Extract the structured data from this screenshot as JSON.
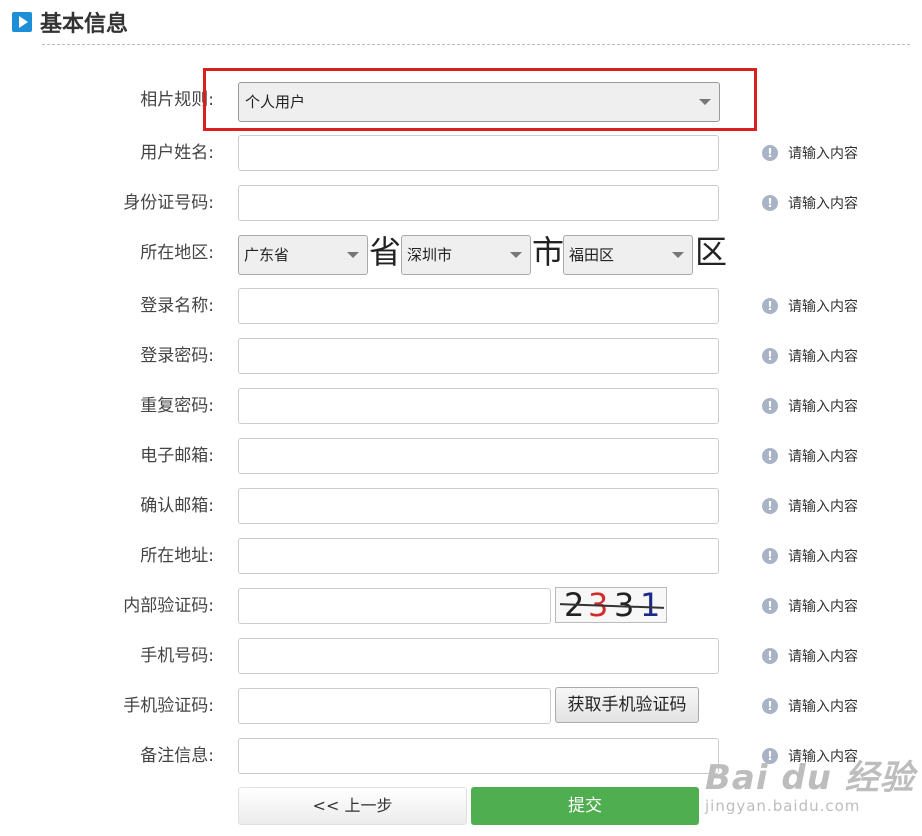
{
  "section": {
    "title": "基本信息"
  },
  "fields": {
    "photo_rule": {
      "label": "相片规则:",
      "value": "个人用户"
    },
    "username": {
      "label": "用户姓名:"
    },
    "id_number": {
      "label": "身份证号码:"
    },
    "region": {
      "label": "所在地区:",
      "province": "广东省",
      "province_unit": "省",
      "city": "深圳市",
      "city_unit": "市",
      "district": "福田区",
      "district_unit": "区"
    },
    "login_name": {
      "label": "登录名称:"
    },
    "password": {
      "label": "登录密码:"
    },
    "repeat_password": {
      "label": "重复密码:"
    },
    "email": {
      "label": "电子邮箱:"
    },
    "confirm_email": {
      "label": "确认邮箱:"
    },
    "address": {
      "label": "所在地址:"
    },
    "internal_code": {
      "label": "内部验证码:",
      "captcha": [
        "2",
        "3",
        "3",
        "1"
      ]
    },
    "mobile": {
      "label": "手机号码:"
    },
    "sms_code": {
      "label": "手机验证码:",
      "button": "获取手机验证码"
    },
    "remarks": {
      "label": "备注信息:"
    }
  },
  "hint_text": "请输入内容",
  "buttons": {
    "prev": "<< 上一步",
    "submit": "提交"
  },
  "watermark": {
    "main": "Bai du 经验",
    "sub": "jingyan.baidu.com"
  },
  "colors": {
    "accent": "#1d8fd8",
    "highlight": "#d9201f",
    "submit": "#4fae4f"
  }
}
